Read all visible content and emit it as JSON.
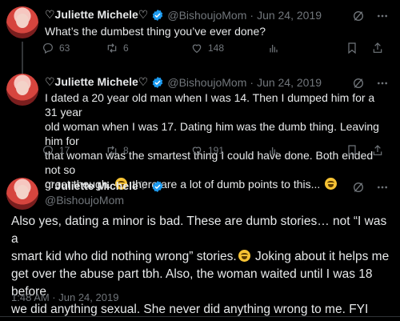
{
  "tweets": [
    {
      "name": "♡Juliette Michele♡",
      "handle": "@BishoujoMom",
      "date": "Jun 24, 2019",
      "text": "What’s the dumbest thing you’ve ever done?",
      "replies": "63",
      "retweets": "6",
      "likes": "148"
    },
    {
      "name": "♡Juliette Michele♡",
      "handle": "@BishoujoMom",
      "date": "Jun 24, 2019",
      "text_line1": "I dated a 20 year old man when I was 14. Then I dumped him for a 31 year",
      "text_line2": "old woman when I was 17. Dating him was the dumb thing. Leaving him for",
      "text_line3": "that woman was the smartest thing I could have done. Both ended not so",
      "text_line4a": "great though.",
      "text_line4b": "there are a lot of dumb points to this...",
      "replies": "17",
      "retweets": "8",
      "likes": "191"
    },
    {
      "name": "♡Juliette Michele♡",
      "handle": "@BishoujoMom",
      "text_line1": "Also yes, dating a minor is bad. These are dumb stories… not “I was a",
      "text_line2a": "smart kid who did nothing wrong” stories.",
      "text_line2b": "Joking about it helps me",
      "text_line3": "get over the abuse part tbh. Also, the woman waited until I was 18 before",
      "text_line4": "we did anything sexual. She never did anything wrong to me. FYI",
      "timestamp": "1:48 AM · Jun 24, 2019"
    }
  ],
  "separator": "·",
  "icons": [
    "verified-badge-icon",
    "grok-icon",
    "more-icon",
    "reply-icon",
    "retweet-icon",
    "like-icon",
    "views-icon",
    "bookmark-icon",
    "share-icon",
    "emoji-grin-sweat",
    "emoji-grimace",
    "emoji-laugh-cry"
  ],
  "colors": {
    "background": "#000000",
    "text": "#e7e9ea",
    "muted": "#71767b",
    "verified": "#1d9bf0"
  }
}
